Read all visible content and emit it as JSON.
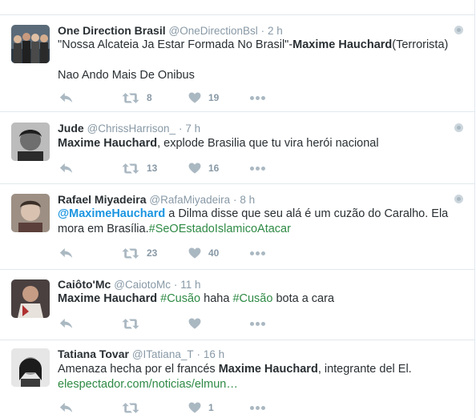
{
  "tweets": [
    {
      "fullname": "One Direction Brasil",
      "username": "@OneDirectionBsl",
      "separator": "·",
      "time": "2 h",
      "line1": [
        "\"Nossa Alcateia Ja Estar Formada No Brasil\"-",
        "Maxime Hauchard",
        "(Terrorista)"
      ],
      "line2": "Nao Ando Mais De Onibus",
      "retweets": "8",
      "likes": "19"
    },
    {
      "fullname": "Jude",
      "username": "@ChrissHarrison_",
      "separator": "·",
      "time": "7 h",
      "parts": [
        "Maxime Hauchard",
        ", explode Brasilia que tu vira herói nacional"
      ],
      "retweets": "13",
      "likes": "16"
    },
    {
      "fullname": "Rafael Miyadeira",
      "username": "@RafaMiyadeira",
      "separator": "·",
      "time": "8 h",
      "parts": [
        "@MaximeHauchard",
        " a Dilma disse que seu alá é um cuzão do Caralho. Ela",
        "mora em Brasília.",
        "#SeOEstadoIslamicoAtacar"
      ],
      "retweets": "23",
      "likes": "40"
    },
    {
      "fullname": "Caiôto'Mc",
      "username": "@CaiotoMc",
      "separator": "·",
      "time": "11 h",
      "parts": [
        "Maxime Hauchard",
        " ",
        "#Cusão",
        " haha ",
        "#Cusão",
        " bota a cara"
      ],
      "retweets": "",
      "likes": ""
    },
    {
      "fullname": "Tatiana Tovar",
      "username": "@ITatiana_T",
      "separator": "·",
      "time": "16 h",
      "parts": [
        "Amenaza hecha por el francés ",
        "Maxime Hauchard",
        ", integrante del El."
      ],
      "link": "elespectador.com/noticias/elmun…",
      "retweets": "",
      "likes": "1"
    }
  ],
  "icons": {
    "reply": "reply-icon",
    "retweet": "retweet-icon",
    "like": "heart-icon",
    "more": "more-icon",
    "globe": "globe-icon"
  },
  "colors": {
    "icon_gray": "#aab8c2",
    "mention_blue": "#1b95e0",
    "hashtag_green": "#2e8a45"
  }
}
